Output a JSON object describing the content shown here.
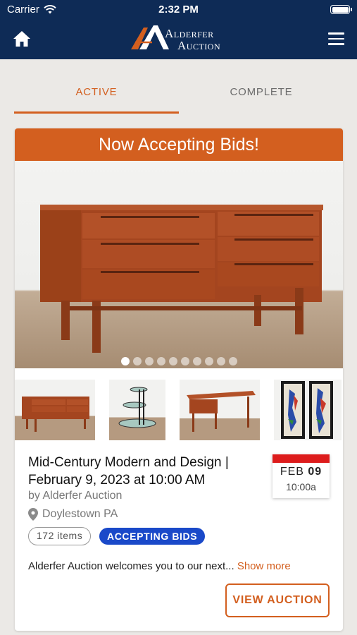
{
  "status_bar": {
    "carrier": "Carrier",
    "time": "2:32 PM"
  },
  "header": {
    "logo_line1": "Alderfer",
    "logo_line2": "Auction"
  },
  "tabs": [
    {
      "label": "ACTIVE",
      "selected": true
    },
    {
      "label": "COMPLETE",
      "selected": false
    }
  ],
  "card": {
    "banner": "Now Accepting Bids!",
    "image_count": 10,
    "active_image": 1,
    "title": "Mid-Century Modern and Design | February 9, 2023 at 10:00 AM",
    "by": "by Alderfer Auction",
    "location": "Doylestown PA",
    "date_month": "FEB",
    "date_day": "09",
    "date_time": "10:00a",
    "items_count": "172 items",
    "status": "ACCEPTING BIDS",
    "description": "Alderfer Auction welcomes you to our next...",
    "show_more": "Show more",
    "view_button": "VIEW AUCTION"
  },
  "colors": {
    "navy": "#0e2b56",
    "accent": "#d35f1f",
    "status_blue": "#1a49c9",
    "date_red": "#dd1c1c"
  },
  "icons": [
    "home-icon",
    "menu-icon",
    "wifi-icon",
    "battery-icon",
    "location-pin-icon"
  ]
}
